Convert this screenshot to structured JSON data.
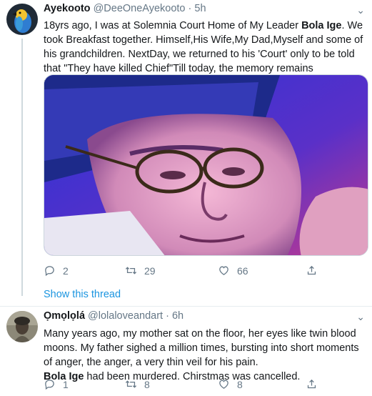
{
  "tweets": [
    {
      "name": "Ayekooto",
      "handle": "@DeeOneAyekooto",
      "time": "5h",
      "text_before": "18yrs ago, I was at Solemnia Court Home of My Leader ",
      "text_bold": "Bola Ige",
      "text_after": ". We took Breakfast together. Himself,His Wife,My Dad,Myself and some of his grandchildren. NextDay, we returned to his 'Court' only to be told that \"They have killed Chief\"Till today, the memory remains unforgettable.",
      "replies": "2",
      "retweets": "29",
      "likes": "66",
      "show_thread": "Show this thread"
    },
    {
      "name": "Ọmọlọlá",
      "handle": "@lolaloveandart",
      "time": "6h",
      "text_line1": "Many years ago, my mother sat on the floor, her eyes like twin blood moons. My father sighed a million times, bursting into short moments of anger, the anger, a very thin veil for his pain.",
      "text_bold": "Bola Ige",
      "text_line2_after": " had been murdered. Chirstmas was cancelled.",
      "replies": "1",
      "retweets": "8",
      "likes": "8"
    }
  ],
  "separator": "·",
  "colors": {
    "text": "#14171a",
    "secondary": "#657786",
    "link": "#1b95e0",
    "border": "#e6ecf0"
  },
  "icons": [
    "reply-icon",
    "retweet-icon",
    "like-icon",
    "share-icon",
    "chevron-down-icon"
  ]
}
